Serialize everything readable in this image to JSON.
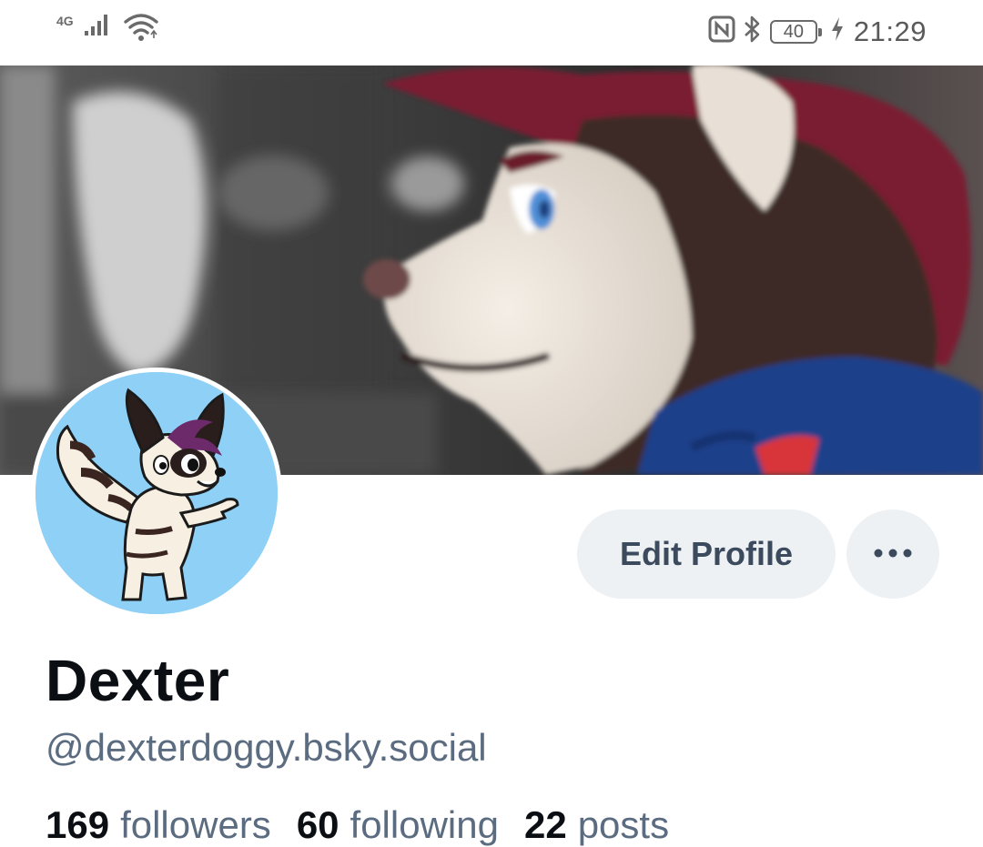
{
  "status_bar": {
    "network_type": "4G",
    "battery_level": "40",
    "time": "21:29",
    "icons": [
      "signal-icon",
      "wifi-icon",
      "nfc-icon",
      "bluetooth-icon",
      "battery-icon",
      "charging-icon"
    ]
  },
  "profile": {
    "display_name": "Dexter",
    "handle": "@dexterdoggy.bsky.social",
    "stats": {
      "followers_count": "169",
      "followers_label": "followers",
      "following_count": "60",
      "following_label": "following",
      "posts_count": "22",
      "posts_label": "posts"
    }
  },
  "actions": {
    "edit_profile_label": "Edit Profile",
    "more_icon": "ellipsis-icon"
  },
  "colors": {
    "button_bg": "#eef1f4",
    "button_text": "#3b4a5c",
    "secondary_text": "#5b6b80",
    "primary_text": "#0b0f14",
    "avatar_bg": "#8fd0f6"
  }
}
